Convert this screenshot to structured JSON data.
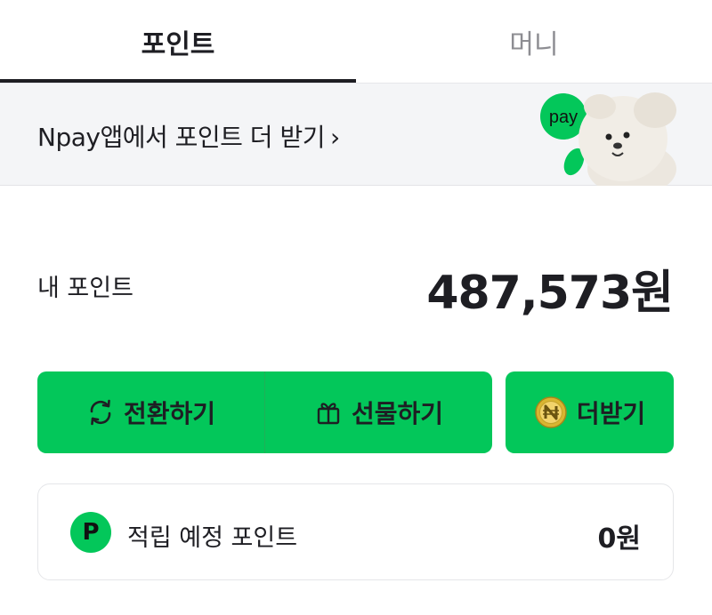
{
  "tabs": [
    {
      "label": "포인트",
      "active": true
    },
    {
      "label": "머니",
      "active": false
    }
  ],
  "banner": {
    "text": "Npay앱에서 포인트 더 받기",
    "chevron": "›",
    "mascot_badge": "pay"
  },
  "my_points": {
    "label": "내 포인트",
    "value": "487,573원"
  },
  "actions": {
    "convert_label": "전환하기",
    "convert_icon": "refresh-icon",
    "gift_label": "선물하기",
    "gift_icon": "gift-icon",
    "more_label": "더받기",
    "more_icon": "npay-coin-icon"
  },
  "pending": {
    "badge": "P",
    "label": "적립 예정 포인트",
    "value": "0원"
  },
  "colors": {
    "accent": "#03c75a",
    "text": "#1e1e23",
    "muted": "#8d8d92",
    "banner_bg": "#f4f5f7"
  }
}
